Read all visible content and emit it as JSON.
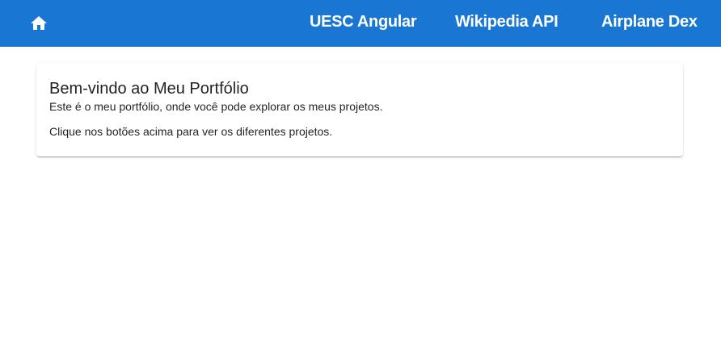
{
  "toolbar": {
    "home_icon": "home-icon",
    "links": [
      {
        "label": "UESC Angular"
      },
      {
        "label": "Wikipedia API"
      },
      {
        "label": "Airplane Dex"
      }
    ]
  },
  "card": {
    "title": "Bem-vindo ao Meu Portfólio",
    "paragraph1": "Este é o meu portfólio, onde você pode explorar os meus projetos.",
    "paragraph2": "Clique nos botões acima para ver os diferentes projetos."
  },
  "colors": {
    "toolbar_bg": "#1976d2",
    "toolbar_text": "#ffffff"
  }
}
